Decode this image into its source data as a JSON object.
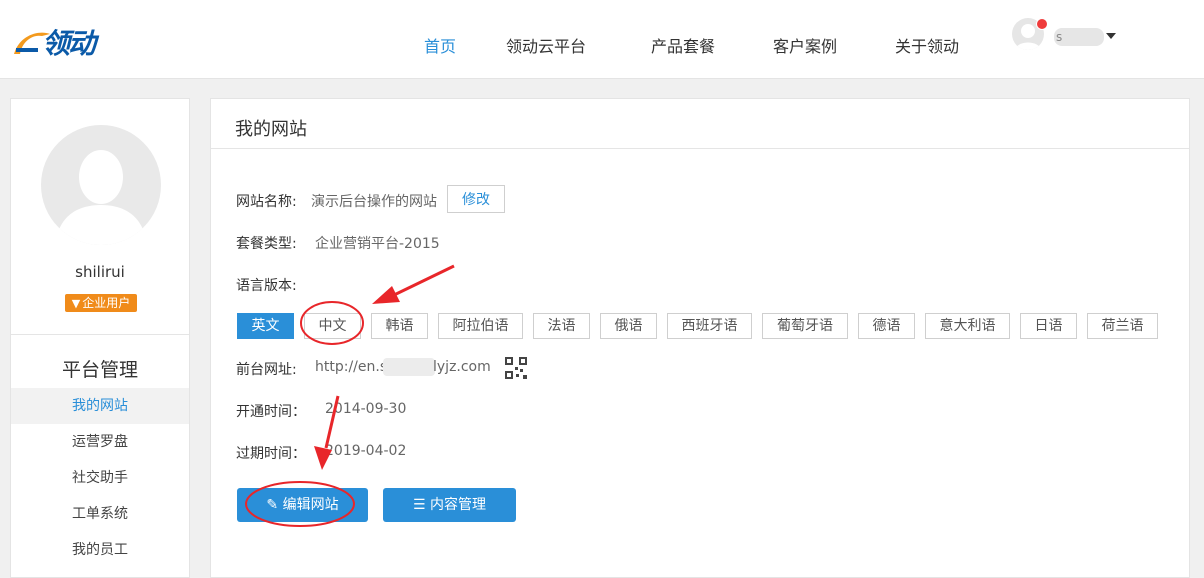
{
  "header": {
    "logo_text": "领动",
    "nav": [
      {
        "label": "首页",
        "active": true
      },
      {
        "label": "领动云平台",
        "active": false
      },
      {
        "label": "产品套餐",
        "active": false
      },
      {
        "label": "客户案例",
        "active": false
      },
      {
        "label": "关于领动",
        "active": false
      }
    ],
    "user_name_partial": "s"
  },
  "sidebar": {
    "username": "shilirui",
    "badge": "企业用户",
    "section_title": "平台管理",
    "items": [
      {
        "label": "我的网站",
        "active": true
      },
      {
        "label": "运营罗盘",
        "active": false
      },
      {
        "label": "社交助手",
        "active": false
      },
      {
        "label": "工单系统",
        "active": false
      },
      {
        "label": "我的员工",
        "active": false
      }
    ]
  },
  "main": {
    "title": "我的网站",
    "site_name_label": "网站名称:",
    "site_name_value": "演示后台操作的网站",
    "edit_name_button": "修改",
    "package_label": "套餐类型:",
    "package_value": "企业营销平台-2015",
    "language_label": "语言版本:",
    "languages": [
      "英文",
      "中文",
      "韩语",
      "阿拉伯语",
      "法语",
      "俄语",
      "西班牙语",
      "葡萄牙语",
      "德语",
      "意大利语",
      "日语",
      "荷兰语"
    ],
    "active_language": "英文",
    "frontend_url_label": "前台网址:",
    "frontend_url_prefix": "http://en.s",
    "frontend_url_suffix": "lyjz.com",
    "open_time_label": "开通时间：",
    "open_time_value": "2014-09-30",
    "expire_time_label": "过期时间：",
    "expire_time_value": "2019-04-02",
    "edit_site_button": "编辑网站",
    "content_manage_button": "内容管理"
  },
  "colors": {
    "accent": "#2a8fd8",
    "badge": "#f08b1a",
    "annotation": "#e8262a"
  }
}
